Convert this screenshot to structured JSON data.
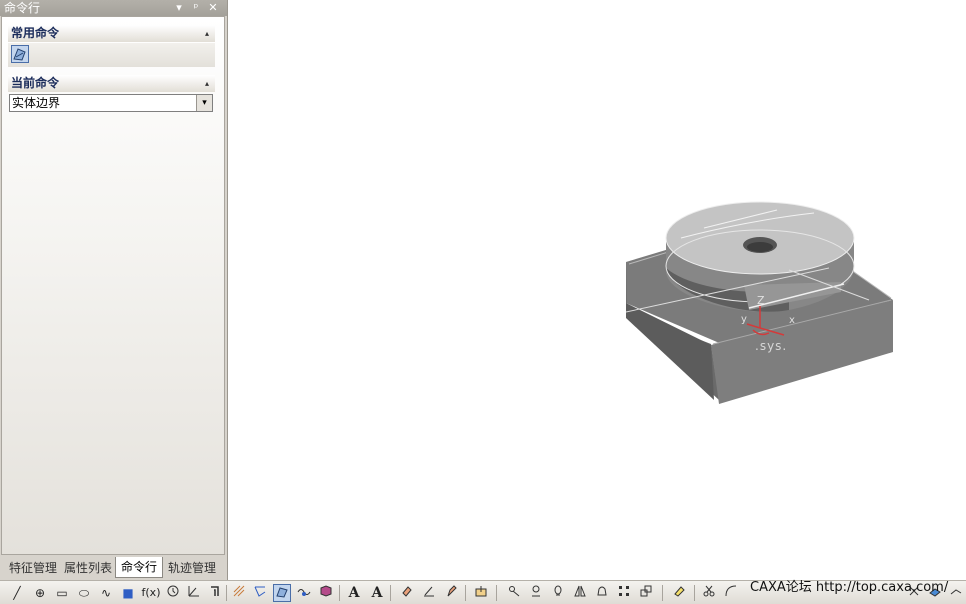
{
  "panel": {
    "title": "命令行",
    "controls": [
      "▾",
      "ᵖ",
      "✕"
    ],
    "common_section": {
      "title": "常用命令",
      "collapse_glyph": "▴"
    },
    "current_section": {
      "title": "当前命令",
      "collapse_glyph": "▴"
    },
    "current_command": {
      "value": "实体边界",
      "dropdown_glyph": "▾"
    }
  },
  "tabs": [
    {
      "label": "特征管理",
      "active": false
    },
    {
      "label": "属性列表",
      "active": false
    },
    {
      "label": "命令行",
      "active": true
    },
    {
      "label": "轨迹管理",
      "active": false
    }
  ],
  "viewport": {
    "axis_label": "Z",
    "axis_label_y": "y",
    "axis_label_x": "x",
    "sys_label": ".sys."
  },
  "toolbar": {
    "glyphs": {
      "line": "╱",
      "circle": "⊕",
      "rect": "▭",
      "ellipse": "⬭",
      "spline": "∿",
      "point": "■",
      "fx": "f(x)",
      "text_a": "A",
      "text_aa": "A"
    }
  },
  "watermark": "CAXA论坛 http://top.caxa.com/",
  "colors": {
    "accent": "#4a6ea8",
    "model_gray": "#8a8a8a"
  }
}
